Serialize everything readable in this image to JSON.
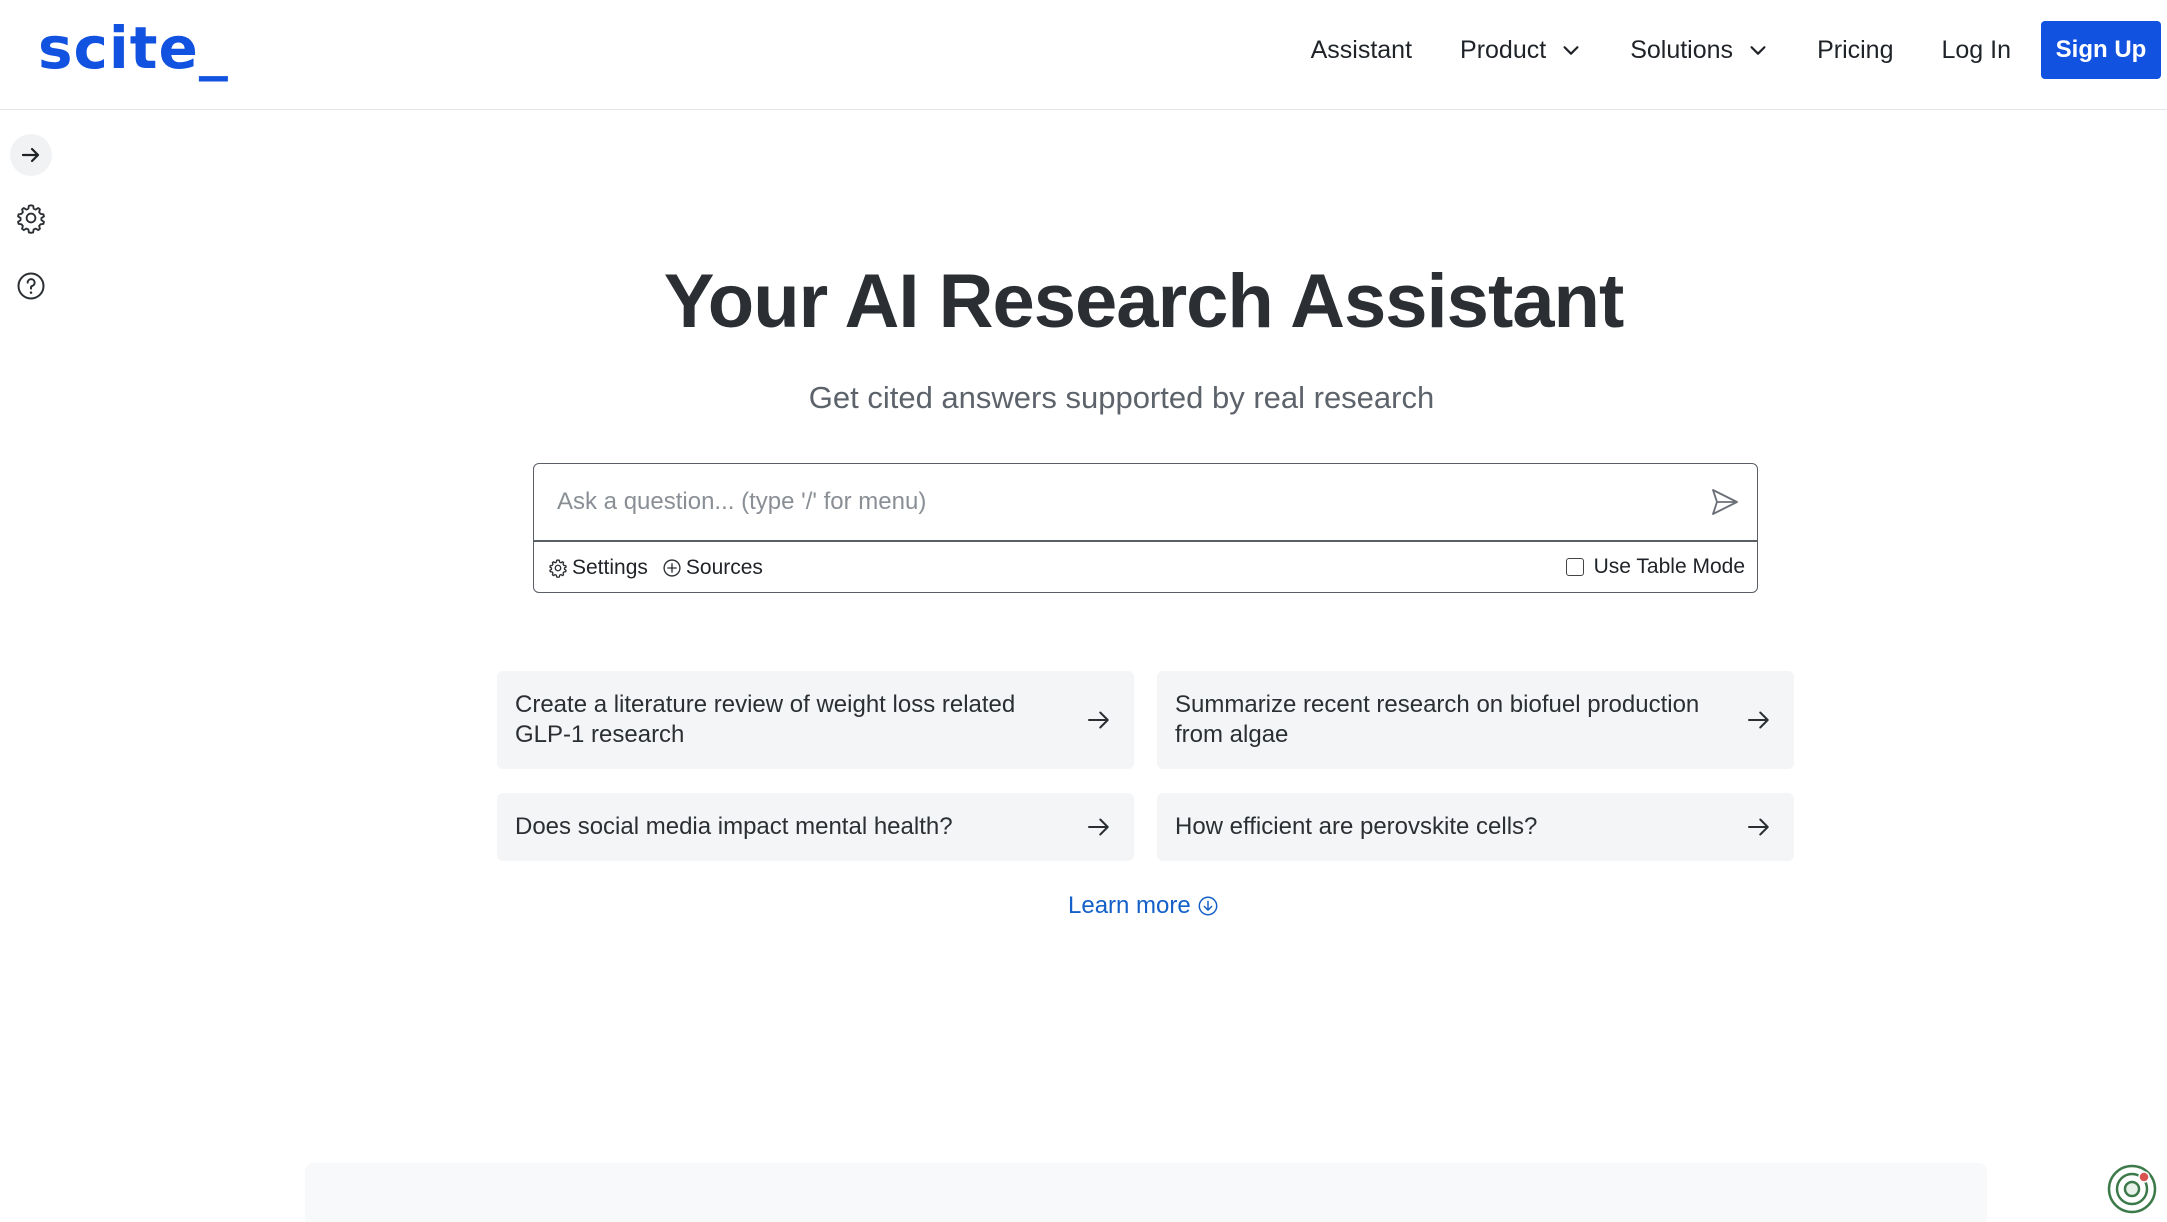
{
  "header": {
    "logo": "scite_",
    "nav": {
      "assistant": "Assistant",
      "product": "Product",
      "solutions": "Solutions",
      "pricing": "Pricing",
      "login": "Log In",
      "signup": "Sign Up"
    }
  },
  "sidebar": {
    "icons": [
      "arrow-right-icon",
      "gear-icon",
      "help-circle-icon"
    ]
  },
  "hero": {
    "title": "Your AI Research Assistant",
    "subtitle": "Get cited answers supported by real research"
  },
  "search": {
    "placeholder": "Ask a question... (type '/' for menu)",
    "value": "",
    "settings_label": "Settings",
    "sources_label": "Sources",
    "table_mode_label": "Use Table Mode",
    "table_mode_checked": false
  },
  "suggestions": [
    "Create a literature review of weight loss related GLP-1 research",
    "Summarize recent research on biofuel production from algae",
    "Does social media impact mental health?",
    "How efficient are perovskite cells?"
  ],
  "learn_more": "Learn more",
  "colors": {
    "brand": "#1152e0",
    "link": "#1460c8",
    "card_bg": "#f4f5f6"
  }
}
